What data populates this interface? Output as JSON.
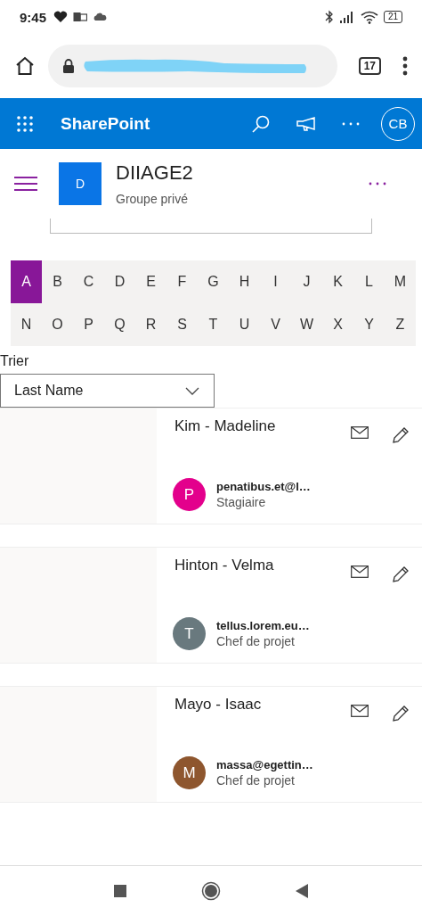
{
  "status_bar": {
    "time": "9:45",
    "battery": "21"
  },
  "browser": {
    "tab_count": "17"
  },
  "app_bar": {
    "title": "SharePoint",
    "avatar": "CB"
  },
  "site": {
    "logo": "D",
    "name": "DIIAGE2",
    "subtitle": "Groupe privé"
  },
  "alphabet": [
    {
      "letter": "A",
      "selected": true
    },
    {
      "letter": "B",
      "selected": false
    },
    {
      "letter": "C",
      "selected": false
    },
    {
      "letter": "D",
      "selected": false
    },
    {
      "letter": "E",
      "selected": false
    },
    {
      "letter": "F",
      "selected": false
    },
    {
      "letter": "G",
      "selected": false
    },
    {
      "letter": "H",
      "selected": false
    },
    {
      "letter": "I",
      "selected": false
    },
    {
      "letter": "J",
      "selected": false
    },
    {
      "letter": "K",
      "selected": false
    },
    {
      "letter": "L",
      "selected": false
    },
    {
      "letter": "M",
      "selected": false
    },
    {
      "letter": "N",
      "selected": false
    },
    {
      "letter": "O",
      "selected": false
    },
    {
      "letter": "P",
      "selected": false
    },
    {
      "letter": "Q",
      "selected": false
    },
    {
      "letter": "R",
      "selected": false
    },
    {
      "letter": "S",
      "selected": false
    },
    {
      "letter": "T",
      "selected": false
    },
    {
      "letter": "U",
      "selected": false
    },
    {
      "letter": "V",
      "selected": false
    },
    {
      "letter": "W",
      "selected": false
    },
    {
      "letter": "X",
      "selected": false
    },
    {
      "letter": "Y",
      "selected": false
    },
    {
      "letter": "Z",
      "selected": false
    }
  ],
  "sort": {
    "label": "Trier",
    "value": "Last Name"
  },
  "people": [
    {
      "name": "Kim - Madeline",
      "initial": "P",
      "color": "#e3008c",
      "email": "penatibus.et@l…",
      "role": "Stagiaire"
    },
    {
      "name": "Hinton - Velma",
      "initial": "T",
      "color": "#69797e",
      "email": "tellus.lorem.eu…",
      "role": "Chef de projet"
    },
    {
      "name": "Mayo - Isaac",
      "initial": "M",
      "color": "#8e562e",
      "email": "massa@egettin…",
      "role": "Chef de projet"
    }
  ]
}
